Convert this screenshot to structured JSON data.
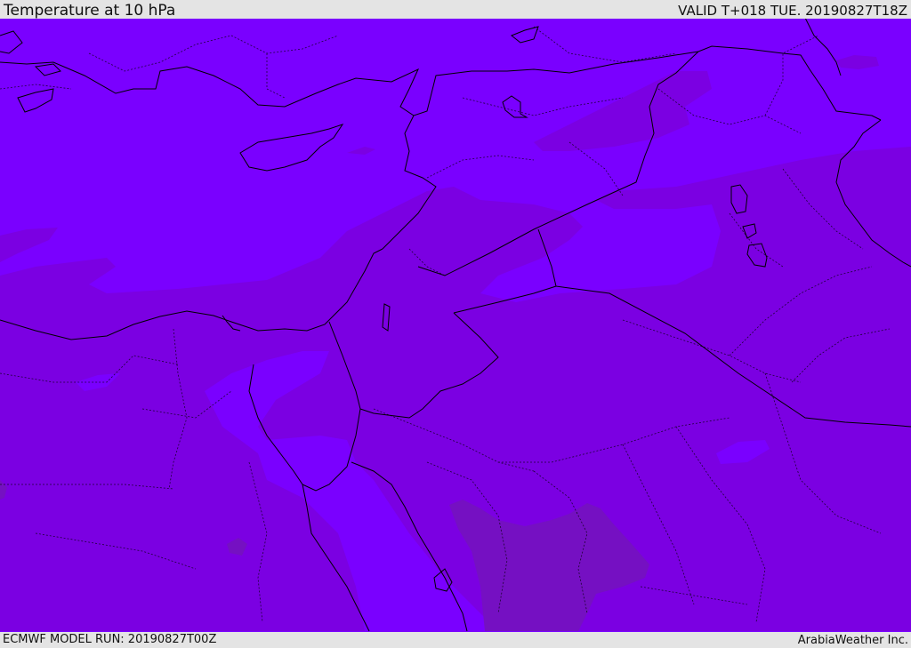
{
  "header": {
    "title": "Temperature at 10 hPa",
    "valid": "VALID T+018 TUE. 20190827T18Z"
  },
  "footer": {
    "model_run": "ECMWF MODEL RUN: 20190827T00Z",
    "brand": "ArabiaWeather Inc."
  },
  "colors": {
    "band_warm": "#7a00ff",
    "band_mid": "#7b00e2",
    "band_cool": "#7510c2",
    "coastline": "#000000",
    "background": "#e4e4e4"
  }
}
